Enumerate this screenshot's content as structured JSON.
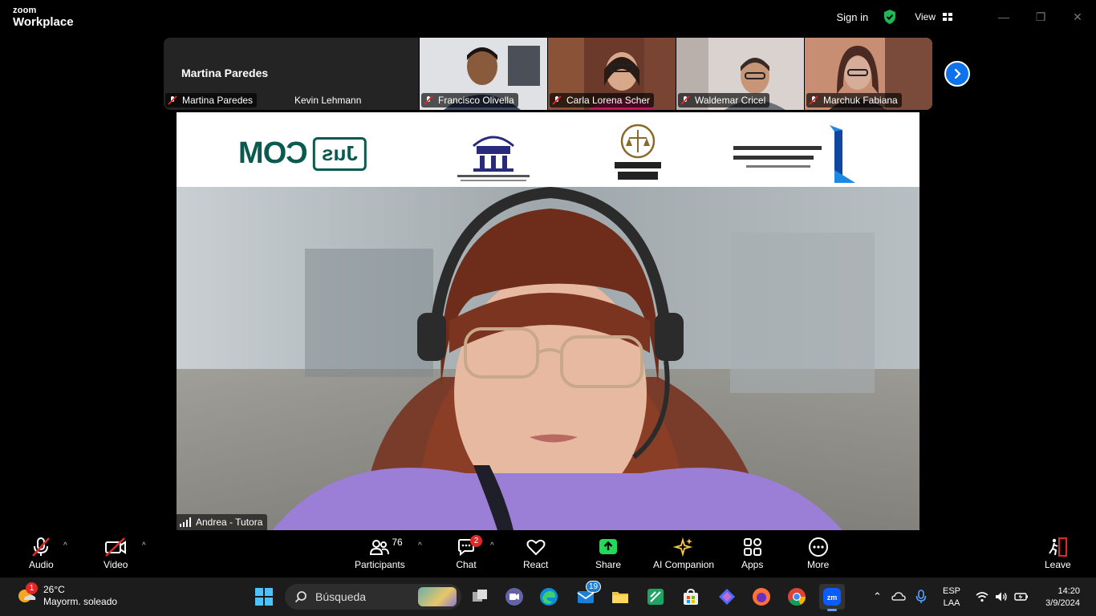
{
  "titlebar": {
    "logo_top": "zoom",
    "logo_bottom": "Workplace",
    "sign_in": "Sign in",
    "view": "View",
    "minimize": "—",
    "restore": "❐",
    "close": "✕"
  },
  "gallery": {
    "active_name": "Martina Paredes",
    "participants": [
      {
        "name": "Martina Paredes",
        "muted": true
      },
      {
        "name": "Kevin Lehmann",
        "muted": false
      },
      {
        "name": "Francisco Olivella",
        "muted": true
      },
      {
        "name": "Carla Lorena Scher",
        "muted": true
      },
      {
        "name": "Waldemar Cricel",
        "muted": true
      },
      {
        "name": "Marchuk Fabiana",
        "muted": true
      }
    ]
  },
  "main": {
    "speaker": "Andrea - Tutora",
    "banner_logo": "JusCOM",
    "banner_jus": "Jus",
    "banner_com": "COM"
  },
  "toolbar": {
    "audio": "Audio",
    "video": "Video",
    "participants": "Participants",
    "participants_count": "76",
    "chat": "Chat",
    "chat_badge": "2",
    "react": "React",
    "share": "Share",
    "ai": "AI Companion",
    "apps": "Apps",
    "more": "More",
    "leave": "Leave"
  },
  "taskbar": {
    "weather_badge": "1",
    "temperature": "26°C",
    "weather_desc": "Mayorm. soleado",
    "search_placeholder": "Búsqueda",
    "mail_badge": "19",
    "lang_top": "ESP",
    "lang_bottom": "LAA",
    "time": "14:20",
    "date": "3/9/2024"
  },
  "colors": {
    "accent": "#0e72ed",
    "share_green": "#23d959",
    "muted_red": "#e02828",
    "shield_green": "#1db954"
  }
}
